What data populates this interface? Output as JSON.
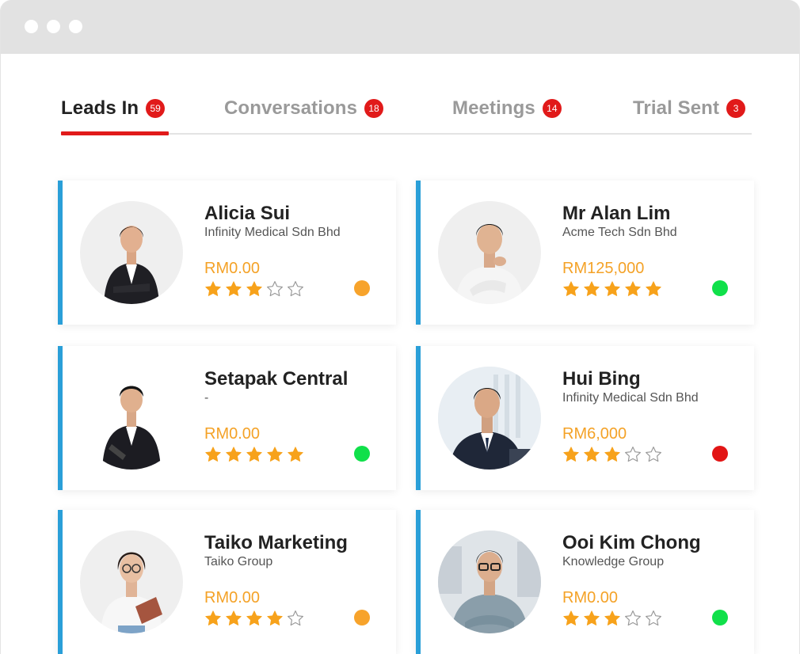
{
  "tabs": [
    {
      "label": "Leads In",
      "count": "59",
      "active": true
    },
    {
      "label": "Conversations",
      "count": "18",
      "active": false
    },
    {
      "label": "Meetings",
      "count": "14",
      "active": false
    },
    {
      "label": "Trial Sent",
      "count": "3",
      "active": false
    }
  ],
  "colors": {
    "accent_red": "#e11a1a",
    "card_border_blue": "#2a9fd8",
    "amount_orange": "#f4a227",
    "star_filled": "#f7a21b",
    "status_orange": "#f7a32b",
    "status_green": "#10e04a",
    "status_red": "#e21515"
  },
  "leads": [
    {
      "name": "Alicia Sui",
      "company": "Infinity Medical Sdn Bhd",
      "amount": "RM0.00",
      "rating": 3,
      "status": "orange",
      "avatar": "woman-suit"
    },
    {
      "name": "Mr Alan Lim",
      "company": "Acme Tech Sdn Bhd",
      "amount": "RM125,000",
      "rating": 5,
      "status": "green",
      "avatar": "man-white-shirt"
    },
    {
      "name": "Setapak Central",
      "company": "-",
      "amount": "RM0.00",
      "rating": 5,
      "status": "green",
      "avatar": "man-suit-tablet"
    },
    {
      "name": "Hui Bing",
      "company": "Infinity Medical Sdn Bhd",
      "amount": "RM6,000",
      "rating": 3,
      "status": "red",
      "avatar": "man-suit-office"
    },
    {
      "name": "Taiko Marketing",
      "company": "Taiko Group",
      "amount": "RM0.00",
      "rating": 4,
      "status": "orange",
      "avatar": "woman-glasses-tablet"
    },
    {
      "name": "Ooi Kim Chong",
      "company": "Knowledge Group",
      "amount": "RM0.00",
      "rating": 3,
      "status": "green",
      "avatar": "man-glasses-office"
    }
  ]
}
